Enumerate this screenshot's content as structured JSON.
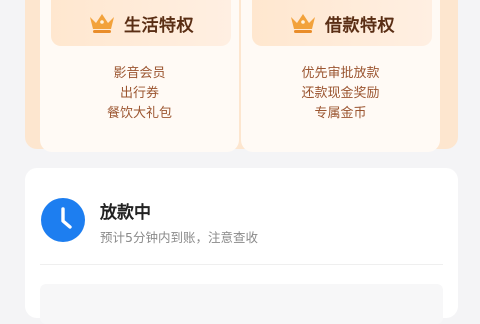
{
  "privileges": {
    "life": {
      "title": "生活特权",
      "icon": "crown-icon",
      "benefits": [
        "影音会员",
        "出行券",
        "餐饮大礼包"
      ]
    },
    "loan": {
      "title": "借款特权",
      "icon": "crown-icon",
      "benefits": [
        "优先审批放款",
        "还款现金奖励",
        "专属金币"
      ]
    }
  },
  "status": {
    "icon": "clock-icon",
    "title": "放款中",
    "subtitle": "预计5分钟内到账，注意查收"
  },
  "colors": {
    "panel_bg": "#fde6cf",
    "card_bg": "#fffaf5",
    "title_brown": "#5a2e14",
    "benefit_brown": "#9b5530",
    "crown_orange": "#f2a23b",
    "clock_blue": "#1d7ef0"
  }
}
